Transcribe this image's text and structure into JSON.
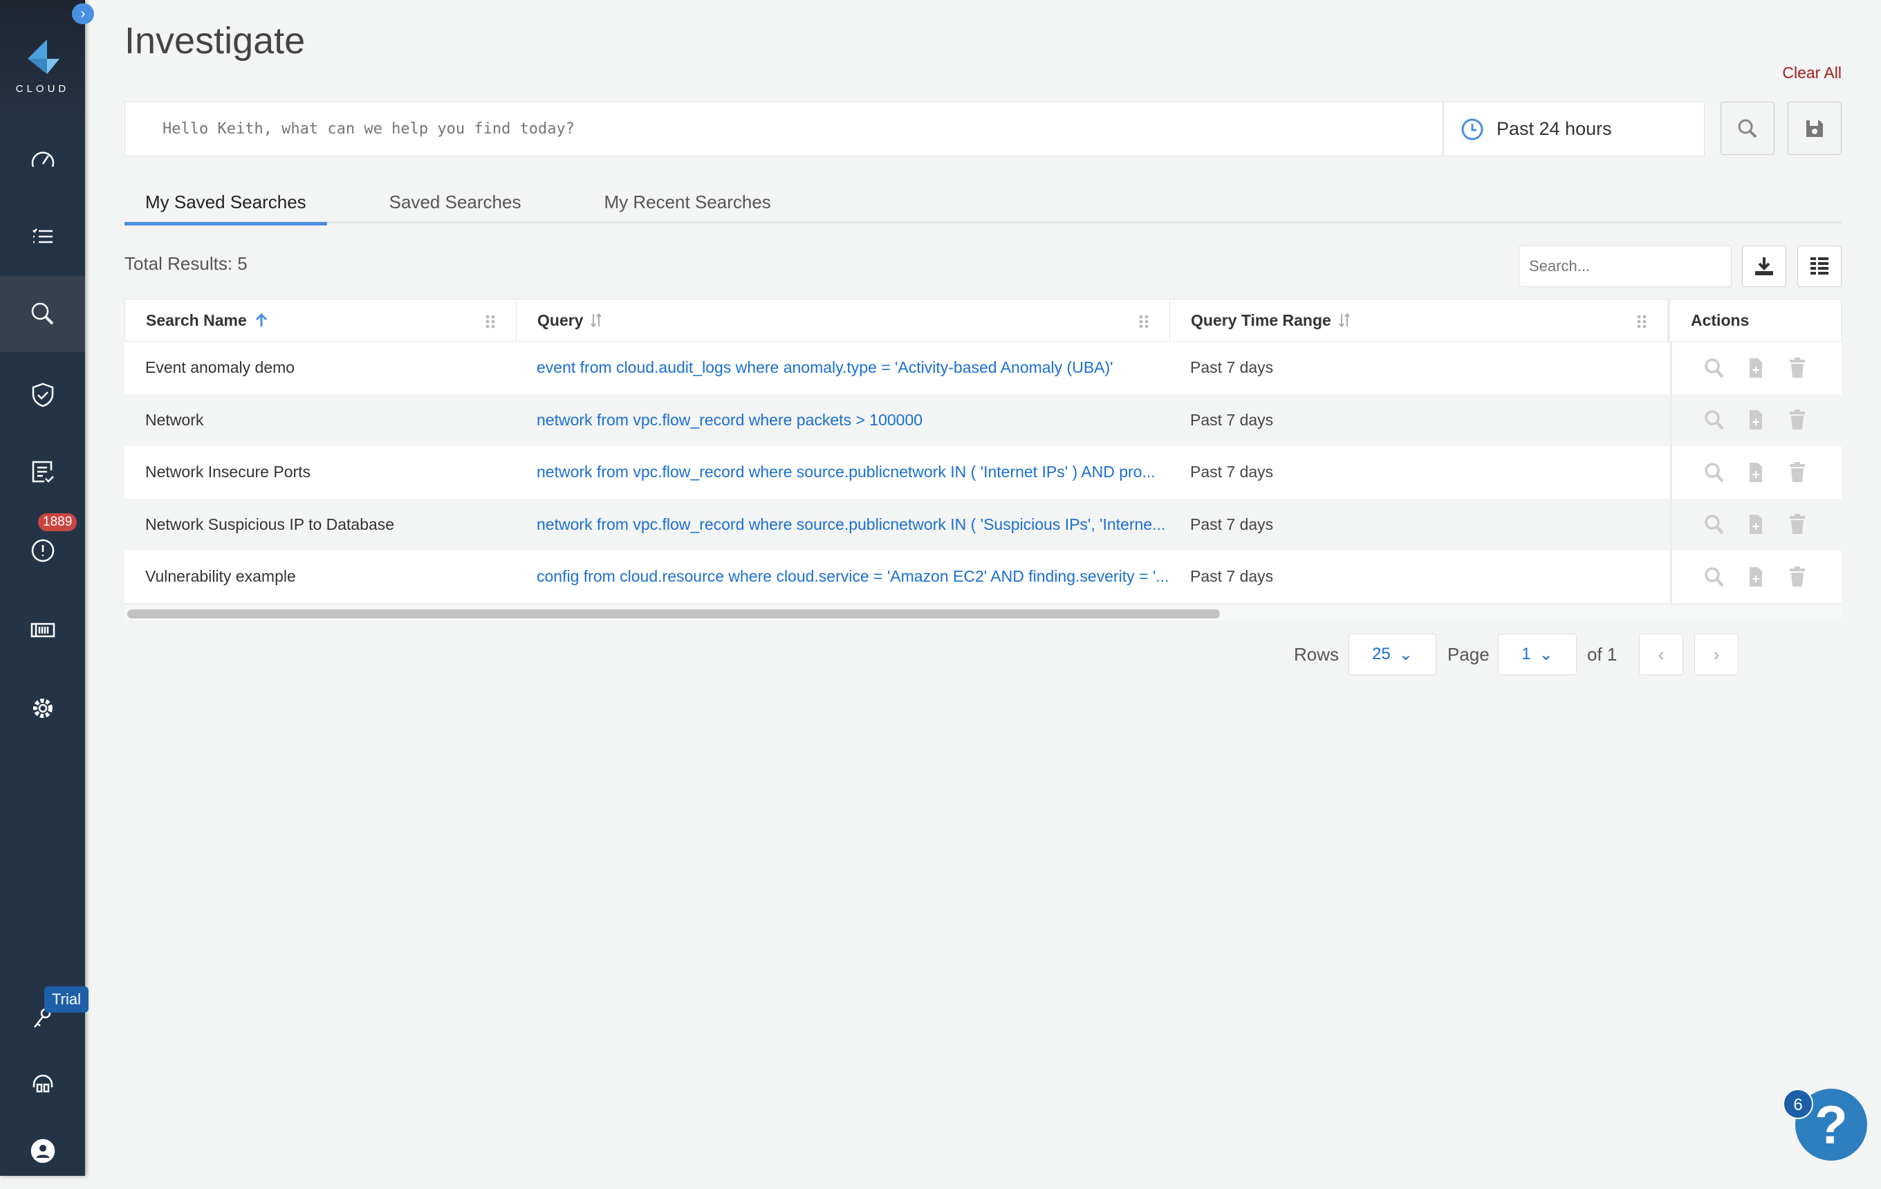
{
  "sidebar": {
    "logo_text": "CLOUD",
    "items": [
      {
        "icon": "dashboard-gauge-icon"
      },
      {
        "icon": "checklist-icon"
      },
      {
        "icon": "search-icon",
        "active": true
      },
      {
        "icon": "shield-check-icon"
      },
      {
        "icon": "report-icon"
      },
      {
        "icon": "alert-icon",
        "badge": "1889"
      },
      {
        "icon": "container-icon"
      },
      {
        "icon": "settings-gear-icon"
      },
      {
        "icon": "key-icon",
        "badge": "Trial"
      },
      {
        "icon": "support-headset-icon"
      },
      {
        "icon": "user-profile-icon"
      }
    ]
  },
  "header": {
    "title": "Investigate",
    "clear_all": "Clear All"
  },
  "search": {
    "placeholder": "Hello Keith, what can we help you find today?",
    "time_range": "Past 24 hours"
  },
  "tabs": [
    {
      "label": "My Saved Searches",
      "active": true
    },
    {
      "label": "Saved Searches"
    },
    {
      "label": "My Recent Searches"
    }
  ],
  "results": {
    "total": "Total Results: 5",
    "search_placeholder": "Search..."
  },
  "table": {
    "columns": [
      "Search Name",
      "Query",
      "Query Time Range",
      "Actions"
    ],
    "rows": [
      {
        "name": "Event anomaly demo",
        "query": "event from cloud.audit_logs where anomaly.type = 'Activity-based Anomaly (UBA)'",
        "range": "Past 7 days"
      },
      {
        "name": "Network",
        "query": "network from vpc.flow_record where packets > 100000",
        "range": "Past 7 days"
      },
      {
        "name": "Network Insecure Ports",
        "query": "network from vpc.flow_record where source.publicnetwork IN ( 'Internet IPs' ) AND pro...",
        "range": "Past 7 days"
      },
      {
        "name": "Network Suspicious IP to Database",
        "query": "network from vpc.flow_record where source.publicnetwork IN ( 'Suspicious IPs', 'Interne...",
        "range": "Past 7 days"
      },
      {
        "name": "Vulnerability example",
        "query": "config from cloud.resource where cloud.service = 'Amazon EC2' AND finding.severity = '...",
        "range": "Past 7 days"
      }
    ]
  },
  "pagination": {
    "rows_label": "Rows",
    "rows_value": "25",
    "page_label": "Page",
    "page_value": "1",
    "of_label": "of 1"
  },
  "help": {
    "label": "?",
    "badge": "6"
  },
  "colors": {
    "accent": "#4a90e2",
    "link": "#1a6fd1",
    "sidebar": "#243447",
    "alert_badge": "#c9453f",
    "clear_all": "#a41d1d"
  }
}
